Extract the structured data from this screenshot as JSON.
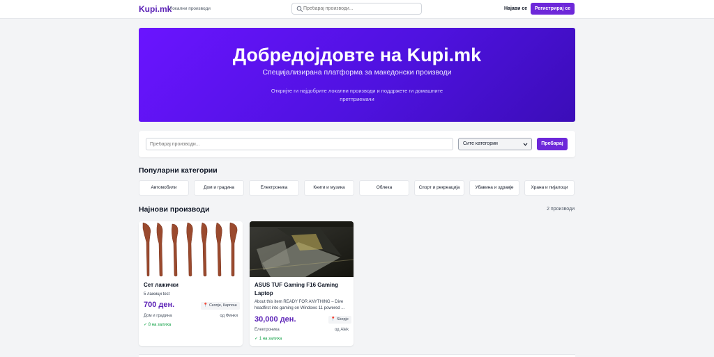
{
  "header": {
    "logo": "Kupi.mk",
    "tagline": "Локални производи",
    "search_placeholder": "Пребарај производи...",
    "login": "Најави се",
    "register": "Регистрирај се"
  },
  "hero": {
    "title": "Добредојдовте на Kupi.mk",
    "subtitle": "Специјализирана платформа за македонски производи",
    "description": "Откријте ги најдобрите локални производи и поддржете ги домашните претприемачи"
  },
  "search": {
    "placeholder": "Пребарај производи...",
    "category_selected": "Сите категории",
    "button": "Пребарај"
  },
  "categories": {
    "title": "Популарни категории",
    "items": [
      "Автомобили",
      "Дом и градина",
      "Електроника",
      "Книги и музика",
      "Облека",
      "Спорт и рекреација",
      "Убавина и здравје",
      "Храна и пијалоци"
    ]
  },
  "products": {
    "title": "Најнови производи",
    "count": "2 производи",
    "items": [
      {
        "title": "Сет лажички",
        "description": "5 лажици test",
        "price": "700 ден.",
        "location": "Скопје, Карпош",
        "category": "Дом и градина",
        "seller": "од Финки",
        "stock": "✓ 8 на залиха"
      },
      {
        "title": "ASUS TUF Gaming F16 Gaming Laptop",
        "description": "About this item READY FOR ANYTHING – Dive headfirst into gaming on Windows 11 powered ...",
        "price": "30,000 ден.",
        "location": "Skopje",
        "category": "Електроника",
        "seller": "од Alek",
        "stock": "✓ 1 на залиха"
      }
    ]
  },
  "colors": {
    "brand": "#6d28d9",
    "hero_start": "#6a14ff",
    "hero_end": "#3b0db8",
    "stock": "#16a34a",
    "price": "#5b21b6"
  },
  "icons": {
    "search": "search-icon",
    "pin": "map-pin-icon",
    "caret": "chevron-down-icon"
  }
}
